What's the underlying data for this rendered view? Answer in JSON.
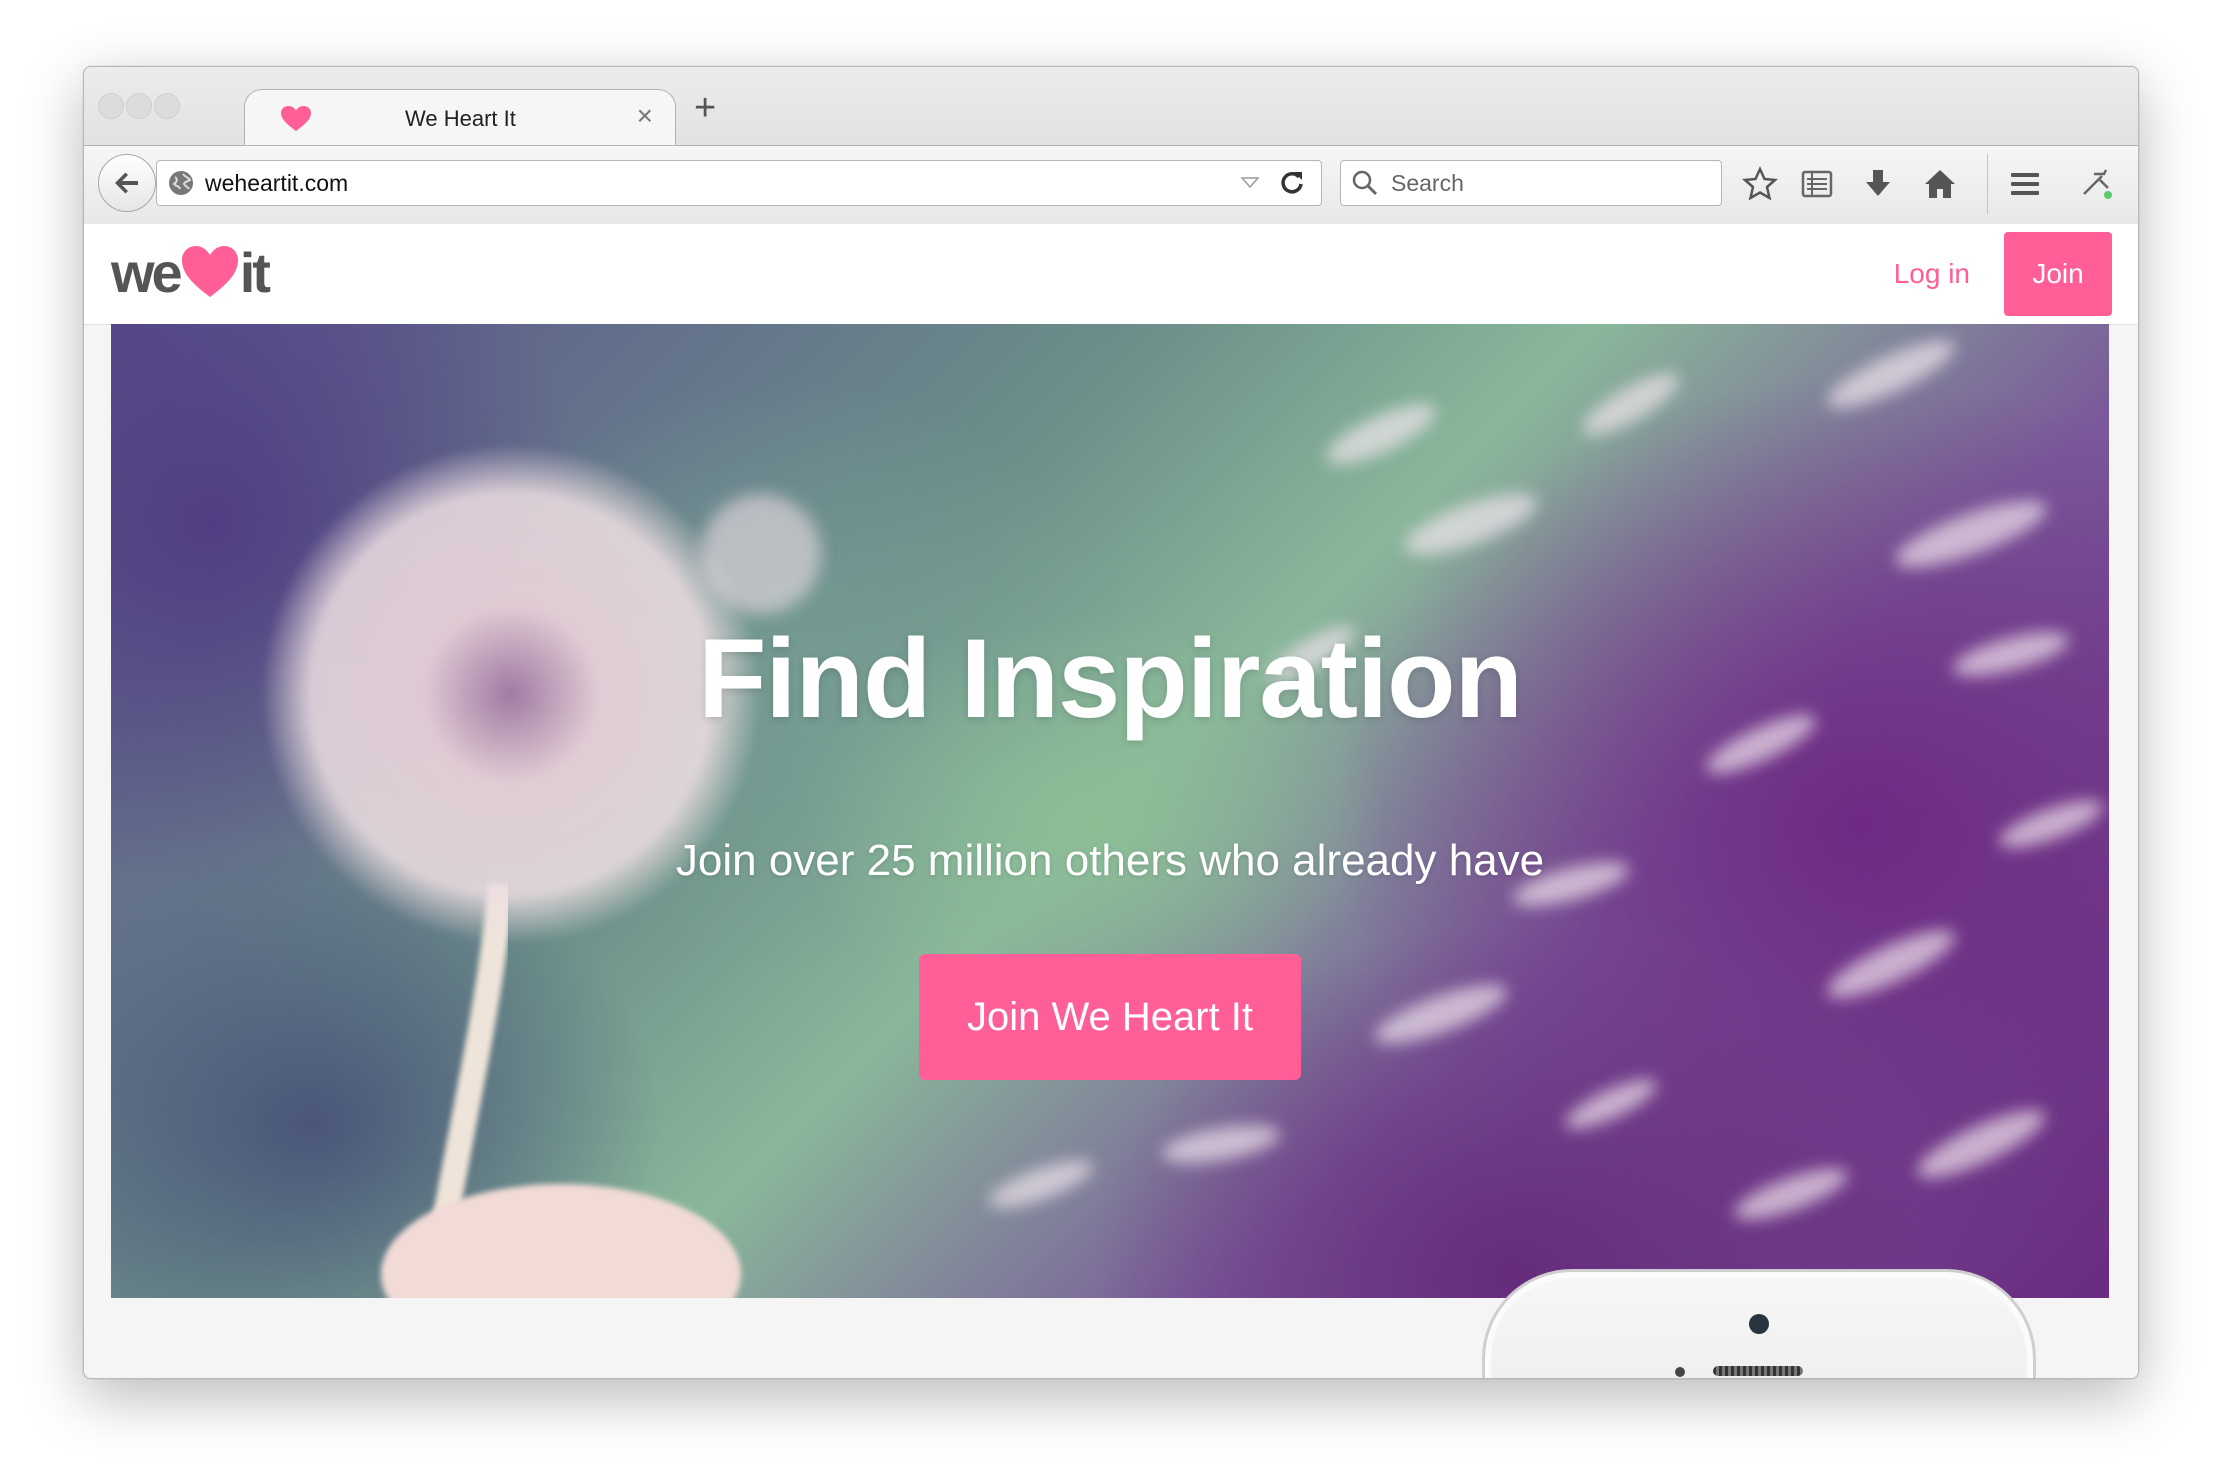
{
  "browser": {
    "tab": {
      "title": "We Heart It",
      "close_glyph": "×",
      "favicon": "heart-icon"
    },
    "new_tab_glyph": "+",
    "address_bar": {
      "url": "weheartit.com"
    },
    "search_bar": {
      "placeholder": "Search"
    },
    "toolbar_icons": [
      "bookmark-star-icon",
      "reading-list-icon",
      "download-icon",
      "home-icon",
      "menu-icon",
      "developer-icon"
    ]
  },
  "site": {
    "logo": {
      "left": "we",
      "right": "it"
    },
    "nav": {
      "login_label": "Log in",
      "join_label": "Join"
    },
    "hero": {
      "title": "Find Inspiration",
      "subtitle": "Join over 25 million others who already have",
      "cta_label": "Join We Heart It"
    }
  },
  "colors": {
    "brand_pink": "#ff5e96",
    "logo_gray": "#555555"
  }
}
